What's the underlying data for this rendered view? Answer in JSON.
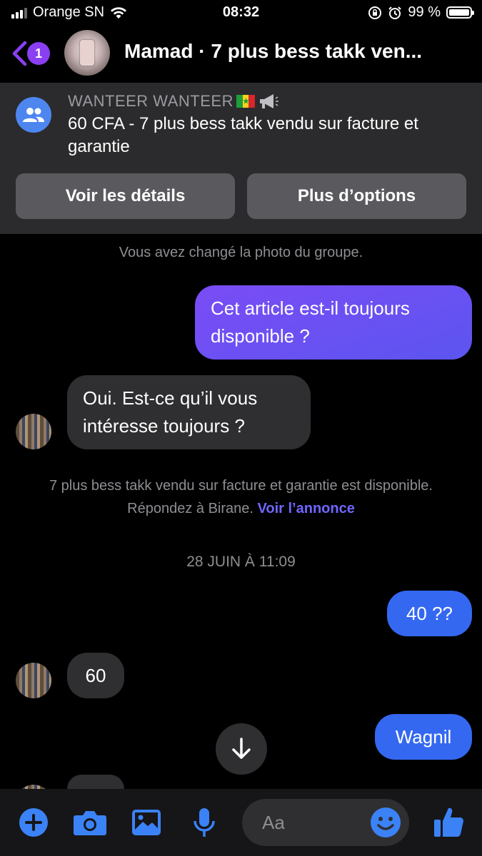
{
  "status_bar": {
    "carrier": "Orange SN",
    "time": "08:32",
    "battery": "99 %",
    "battery_level": 0.99
  },
  "header": {
    "back_count": "1",
    "title": "Mamad · 7 plus bess takk ven..."
  },
  "listing": {
    "seller": "WANTEER WANTEER",
    "description": "60 CFA - 7 plus bess takk vendu sur facture et garantie",
    "details_button": "Voir les détails",
    "options_button": "Plus d’options"
  },
  "messages": {
    "system_photo": "Vous avez changé la photo du groupe.",
    "msg1": "Cet article est-il toujours disponible ?",
    "msg2": "Oui. Est-ce qu’il vous intéresse toujours ?",
    "availability_text": "7 plus bess takk vendu sur facture et garantie est disponible. Répondez à Birane.",
    "availability_link": "Voir l’annonce",
    "date_separator": "28 JUIN À 11:09",
    "msg3": "40 ??",
    "msg4": "60",
    "msg5": "Wagnil"
  },
  "composer": {
    "placeholder": "Aa"
  },
  "colors": {
    "accent_purple": "#8a3ff2",
    "outgoing_blue": "#3468f0",
    "link": "#6f66ff",
    "icon_blue": "#3b82f6"
  }
}
